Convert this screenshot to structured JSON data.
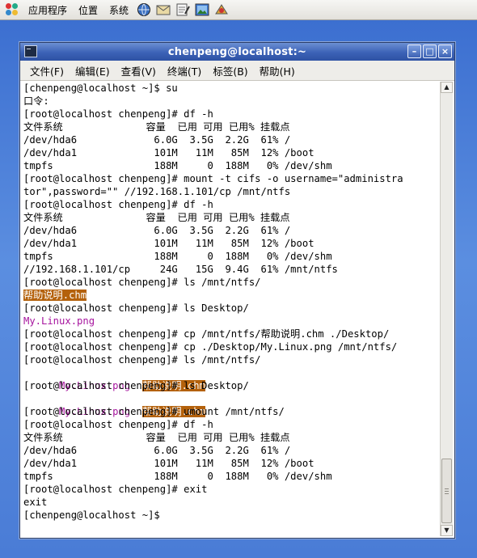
{
  "panel": {
    "menus": [
      "应用程序",
      "位置",
      "系统"
    ]
  },
  "window": {
    "title": "chenpeng@localhost:~",
    "menus": [
      "文件(F)",
      "编辑(E)",
      "查看(V)",
      "终端(T)",
      "标签(B)",
      "帮助(H)"
    ]
  },
  "terminal": {
    "lines": [
      "[chenpeng@localhost ~]$ su",
      "口令:",
      "[root@localhost chenpeng]# df -h",
      "文件系统              容量  已用 可用 已用% 挂载点",
      "/dev/hda6             6.0G  3.5G  2.2G  61% /",
      "/dev/hda1             101M   11M   85M  12% /boot",
      "tmpfs                 188M     0  188M   0% /dev/shm",
      "[root@localhost chenpeng]# mount -t cifs -o username=\"administra",
      "tor\",password=\"\" //192.168.1.101/cp /mnt/ntfs",
      "[root@localhost chenpeng]# df -h",
      "文件系统              容量  已用 可用 已用% 挂载点",
      "/dev/hda6             6.0G  3.5G  2.2G  61% /",
      "/dev/hda1             101M   11M   85M  12% /boot",
      "tmpfs                 188M     0  188M   0% /dev/shm",
      "//192.168.1.101/cp     24G   15G  9.4G  61% /mnt/ntfs",
      "[root@localhost chenpeng]# ls /mnt/ntfs/",
      "帮助说明.chm",
      "[root@localhost chenpeng]# ls Desktop/",
      "My.Linux.png",
      "[root@localhost chenpeng]# cp /mnt/ntfs/帮助说明.chm ./Desktop/",
      "[root@localhost chenpeng]# cp ./Desktop/My.Linux.png /mnt/ntfs/",
      "[root@localhost chenpeng]# ls /mnt/ntfs/",
      "My.Linux.png  帮助说明.chm",
      "[root@localhost chenpeng]# ls Desktop/",
      "My.Linux.png  帮助说明.chm",
      "[root@localhost chenpeng]# umount /mnt/ntfs/",
      "[root@localhost chenpeng]# df -h",
      "文件系统              容量  已用 可用 已用% 挂载点",
      "/dev/hda6             6.0G  3.5G  2.2G  61% /",
      "/dev/hda1             101M   11M   85M  12% /boot",
      "tmpfs                 188M     0  188M   0% /dev/shm",
      "[root@localhost chenpeng]# exit",
      "exit",
      "[chenpeng@localhost ~]$"
    ]
  },
  "colors": {
    "chm_highlight": "#b4610b",
    "png_file": "#a6149e"
  },
  "icons": {
    "apps": "gnome-foot-icon",
    "launchers": [
      "web-browser-icon",
      "email-icon",
      "text-editor-icon",
      "image-viewer-icon",
      "system-settings-icon"
    ]
  }
}
